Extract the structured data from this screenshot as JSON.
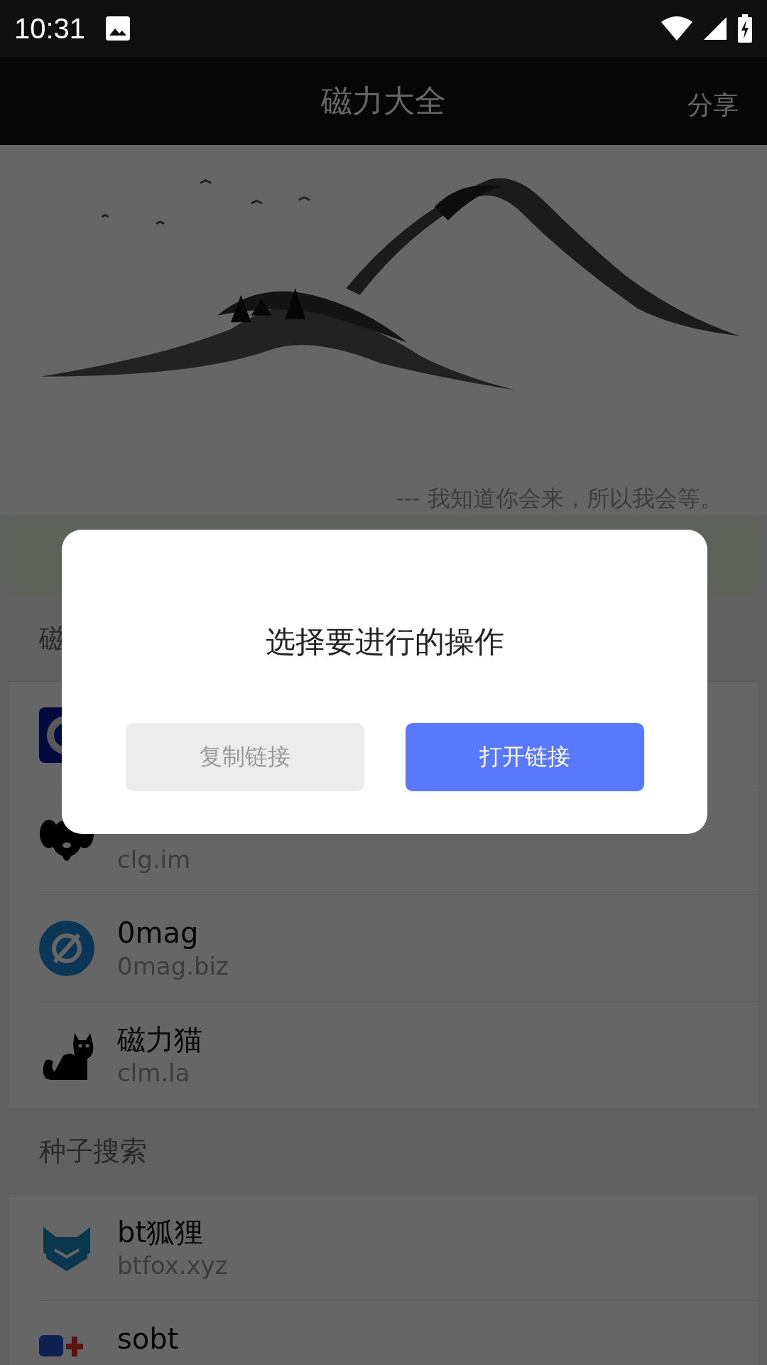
{
  "status_bar": {
    "time": "10:31"
  },
  "app_bar": {
    "title": "磁力大全",
    "action": "分享"
  },
  "hero": {
    "quote": "--- 我知道你会来，所以我会等。"
  },
  "sections": [
    {
      "title": "磁",
      "items": [
        {
          "kind": "c-logo"
        },
        {
          "kind": "dog",
          "url": "clg.im"
        },
        {
          "kind": "empty-set",
          "name": "0mag",
          "url": "0mag.biz"
        },
        {
          "kind": "cat",
          "name": "磁力猫",
          "url": "clm.la"
        }
      ]
    },
    {
      "title": "种子搜索",
      "items": [
        {
          "kind": "fox",
          "name": "bt狐狸",
          "url": "btfox.xyz"
        },
        {
          "kind": "b-plus",
          "name": "sobt"
        }
      ]
    }
  ],
  "dialog": {
    "title": "选择要进行的操作",
    "buttons": [
      {
        "label": "复制链接",
        "kind": "secondary"
      },
      {
        "label": "打开链接",
        "kind": "primary"
      }
    ]
  }
}
